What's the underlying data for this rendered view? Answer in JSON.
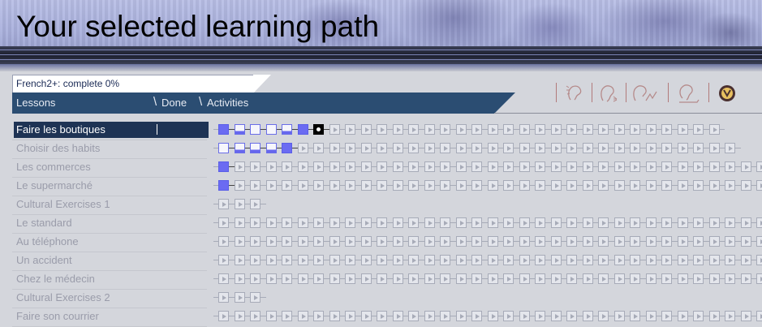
{
  "banner": {
    "title": "Your selected learning path"
  },
  "status": {
    "text": "French2+: complete 0%"
  },
  "columns": {
    "lessons": "Lessons",
    "done": "Done",
    "activities": "Activities"
  },
  "toolbar": {
    "icons": [
      "listen-icon",
      "record-icon",
      "speech-compare-icon",
      "voice-profile-icon",
      "help-icon"
    ]
  },
  "colors": {
    "header_bar": "#2b4d72",
    "selected_row": "#1e3354",
    "completed": "#6b6bf2",
    "pending": "#a7abb8"
  },
  "lessons": [
    {
      "name": "Faire les boutiques",
      "selected": true,
      "activities": [
        "full",
        "partial",
        "empty",
        "empty",
        "partial",
        "full",
        "current",
        "play",
        "play",
        "play",
        "play",
        "play",
        "play",
        "play",
        "play",
        "play",
        "play",
        "play",
        "play",
        "play",
        "play",
        "play",
        "play",
        "play",
        "play",
        "play",
        "play",
        "play",
        "play",
        "play",
        "play",
        "play"
      ]
    },
    {
      "name": "Choisir des habits",
      "selected": false,
      "activities": [
        "empty",
        "partial",
        "partial",
        "partial",
        "full",
        "play",
        "play",
        "play",
        "play",
        "play",
        "play",
        "play",
        "play",
        "play",
        "play",
        "play",
        "play",
        "play",
        "play",
        "play",
        "play",
        "play",
        "play",
        "play",
        "play",
        "play",
        "play",
        "play",
        "play",
        "play",
        "play",
        "play",
        "play"
      ]
    },
    {
      "name": "Les commerces",
      "selected": false,
      "activities": [
        "full",
        "play",
        "play",
        "play",
        "play",
        "play",
        "play",
        "play",
        "play",
        "play",
        "play",
        "play",
        "play",
        "play",
        "play",
        "play",
        "play",
        "play",
        "play",
        "play",
        "play",
        "play",
        "play",
        "play",
        "play",
        "play",
        "play",
        "play",
        "play",
        "play",
        "play",
        "play",
        "play",
        "play",
        "play",
        "play",
        "play",
        "play"
      ]
    },
    {
      "name": "Le supermarché",
      "selected": false,
      "activities": [
        "full",
        "play",
        "play",
        "play",
        "play",
        "play",
        "play",
        "play",
        "play",
        "play",
        "play",
        "play",
        "play",
        "play",
        "play",
        "play",
        "play",
        "play",
        "play",
        "play",
        "play",
        "play",
        "play",
        "play",
        "play",
        "play",
        "play",
        "play",
        "play",
        "play",
        "play",
        "play",
        "play",
        "play",
        "play",
        "play",
        "play",
        "play"
      ]
    },
    {
      "name": "Cultural Exercises 1",
      "selected": false,
      "activities": [
        "play",
        "play",
        "play"
      ]
    },
    {
      "name": "Le standard",
      "selected": false,
      "activities": [
        "play",
        "play",
        "play",
        "play",
        "play",
        "play",
        "play",
        "play",
        "play",
        "play",
        "play",
        "play",
        "play",
        "play",
        "play",
        "play",
        "play",
        "play",
        "play",
        "play",
        "play",
        "play",
        "play",
        "play",
        "play",
        "play",
        "play",
        "play",
        "play",
        "play",
        "play",
        "play",
        "play",
        "play",
        "play",
        "play",
        "play",
        "play"
      ]
    },
    {
      "name": "Au téléphone",
      "selected": false,
      "activities": [
        "play",
        "play",
        "play",
        "play",
        "play",
        "play",
        "play",
        "play",
        "play",
        "play",
        "play",
        "play",
        "play",
        "play",
        "play",
        "play",
        "play",
        "play",
        "play",
        "play",
        "play",
        "play",
        "play",
        "play",
        "play",
        "play",
        "play",
        "play",
        "play",
        "play",
        "play",
        "play",
        "play",
        "play",
        "play",
        "play",
        "play",
        "play"
      ]
    },
    {
      "name": "Un accident",
      "selected": false,
      "activities": [
        "play",
        "play",
        "play",
        "play",
        "play",
        "play",
        "play",
        "play",
        "play",
        "play",
        "play",
        "play",
        "play",
        "play",
        "play",
        "play",
        "play",
        "play",
        "play",
        "play",
        "play",
        "play",
        "play",
        "play",
        "play",
        "play",
        "play",
        "play",
        "play",
        "play",
        "play",
        "play",
        "play",
        "play",
        "play",
        "play",
        "play",
        "play"
      ]
    },
    {
      "name": "Chez le médecin",
      "selected": false,
      "activities": [
        "play",
        "play",
        "play",
        "play",
        "play",
        "play",
        "play",
        "play",
        "play",
        "play",
        "play",
        "play",
        "play",
        "play",
        "play",
        "play",
        "play",
        "play",
        "play",
        "play",
        "play",
        "play",
        "play",
        "play",
        "play",
        "play",
        "play",
        "play",
        "play",
        "play",
        "play",
        "play",
        "play",
        "play",
        "play",
        "play",
        "play",
        "play"
      ]
    },
    {
      "name": "Cultural Exercises 2",
      "selected": false,
      "activities": [
        "play",
        "play",
        "play"
      ]
    },
    {
      "name": "Faire son courrier",
      "selected": false,
      "activities": [
        "play",
        "play",
        "play",
        "play",
        "play",
        "play",
        "play",
        "play",
        "play",
        "play",
        "play",
        "play",
        "play",
        "play",
        "play",
        "play",
        "play",
        "play",
        "play",
        "play",
        "play",
        "play",
        "play",
        "play",
        "play",
        "play",
        "play",
        "play",
        "play",
        "play",
        "play",
        "play",
        "play",
        "play",
        "play",
        "play",
        "play",
        "play"
      ]
    }
  ]
}
